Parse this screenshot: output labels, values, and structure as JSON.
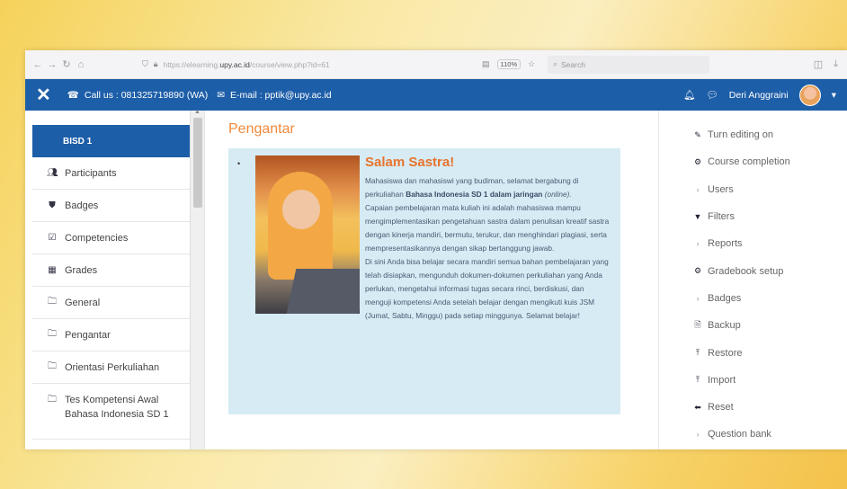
{
  "browser": {
    "nav_back": "←",
    "nav_forward": "→",
    "nav_reload": "↻",
    "nav_home": "⌂",
    "url_prefix": "https://elearning.",
    "url_domain": "upy.ac.id",
    "url_rest": "/course/view.php?id=61",
    "zoom": "110%",
    "search_placeholder": "Search"
  },
  "header": {
    "call": "Call us : 081325719890 (WA)",
    "email": "E-mail : pptik@upy.ac.id",
    "user_name": "Deri Anggraini"
  },
  "left_nav": {
    "course": "BISD 1",
    "items": [
      {
        "label": "Participants",
        "icon": "users-icon"
      },
      {
        "label": "Badges",
        "icon": "shield-icon"
      },
      {
        "label": "Competencies",
        "icon": "check-square-icon"
      },
      {
        "label": "Grades",
        "icon": "table-icon"
      },
      {
        "label": "General",
        "icon": "folder-icon"
      },
      {
        "label": "Pengantar",
        "icon": "folder-icon"
      },
      {
        "label": "Orientasi Perkuliahan",
        "icon": "folder-icon"
      },
      {
        "label": "Tes Kompetensi Awal Bahasa Indonesia SD 1",
        "icon": "folder-icon"
      }
    ]
  },
  "main": {
    "section_title": "Pengantar",
    "salam": "Salam Sastra!",
    "p1_a": "Mahasiswa dan mahasiswi yang budiman, selamat bergabung di perkuliahan ",
    "p1_b": "Bahasa Indonesia SD 1 dalam jaringan",
    "p1_c": " (online).",
    "p2": "Capaian pembelajaran mata kuliah ini adalah mahasiswa mampu mengimplementasikan pengetahuan sastra dalam penulisan kreatif sastra dengan kinerja mandiri, bermutu, terukur, dan menghindari plagiasi, serta mempresentasikannya dengan sikap bertanggung jawab.",
    "p3": "Di sini Anda bisa belajar secara mandiri semua bahan pembelajaran yang telah disiapkan, mengunduh dokumen-dokumen perkuliahan yang Anda perlukan, mengetahui informasi tugas secara rinci, berdiskusi, dan menguji kompetensi Anda setelah belajar dengan mengikuti kuis JSM (Jumat, Sabtu, Minggu) pada setiap minggunya. Selamat belajar!"
  },
  "right_nav": {
    "items": [
      {
        "label": "Turn editing on",
        "icon": "pencil-icon"
      },
      {
        "label": "Course completion",
        "icon": "gear-icon"
      },
      {
        "label": "Users",
        "icon": "chevron-right-icon"
      },
      {
        "label": "Filters",
        "icon": "filter-icon"
      },
      {
        "label": "Reports",
        "icon": "chevron-right-icon"
      },
      {
        "label": "Gradebook setup",
        "icon": "gear-icon"
      },
      {
        "label": "Badges",
        "icon": "chevron-right-icon"
      },
      {
        "label": "Backup",
        "icon": "file-icon"
      },
      {
        "label": "Restore",
        "icon": "upload-icon"
      },
      {
        "label": "Import",
        "icon": "upload-icon"
      },
      {
        "label": "Reset",
        "icon": "arrow-left-icon"
      },
      {
        "label": "Question bank",
        "icon": "chevron-right-icon"
      }
    ]
  },
  "colors": {
    "header_blue": "#1d5ea8",
    "accent_orange": "#f08a3c",
    "panel_blue": "#d6ebf4"
  }
}
